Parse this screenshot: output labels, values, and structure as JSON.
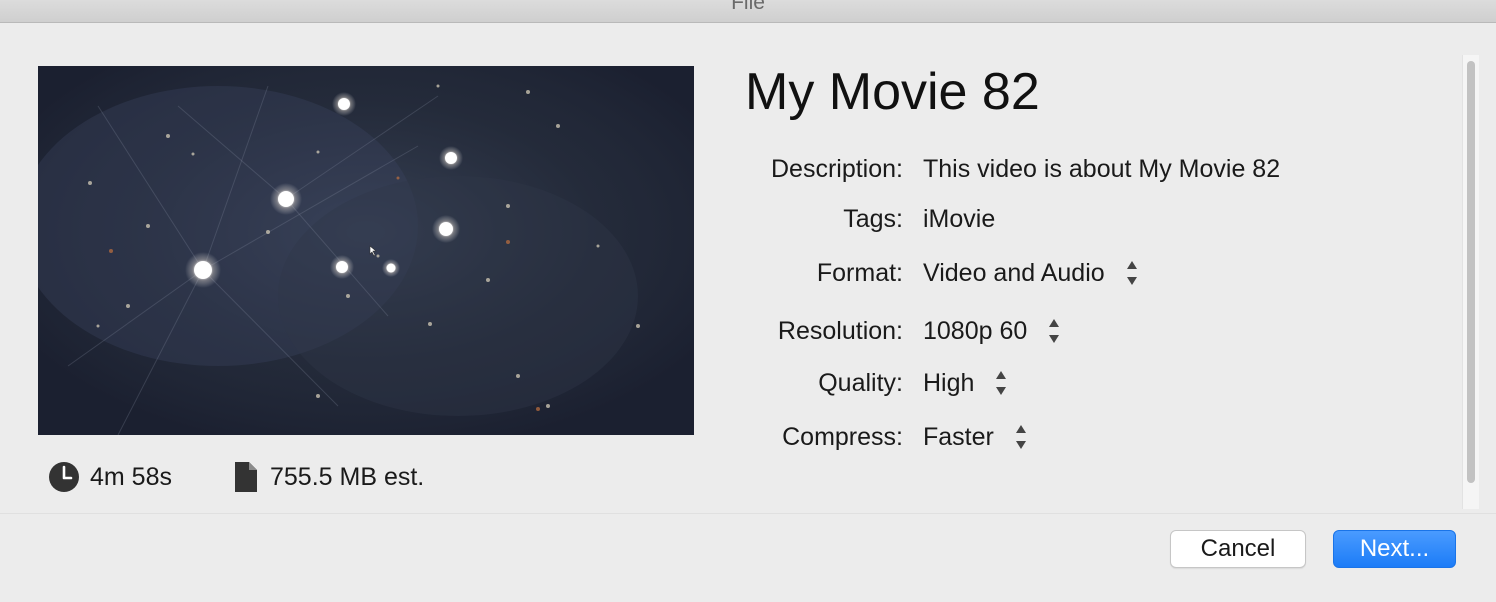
{
  "window": {
    "title": "File"
  },
  "preview": {
    "duration": "4m 58s",
    "file_size": "755.5 MB est.",
    "icons": {
      "duration": "clock-icon",
      "file_size": "document-icon"
    }
  },
  "details": {
    "title": "My Movie 82",
    "description_label": "Description:",
    "description_value": "This video is about My Movie 82",
    "tags_label": "Tags:",
    "tags_value": "iMovie",
    "format_label": "Format:",
    "format_value": "Video and Audio",
    "resolution_label": "Resolution:",
    "resolution_value": "1080p 60",
    "quality_label": "Quality:",
    "quality_value": "High",
    "compress_label": "Compress:",
    "compress_value": "Faster"
  },
  "buttons": {
    "cancel": "Cancel",
    "next": "Next..."
  },
  "colors": {
    "accent": "#1c7cf7",
    "background": "#ececec"
  }
}
